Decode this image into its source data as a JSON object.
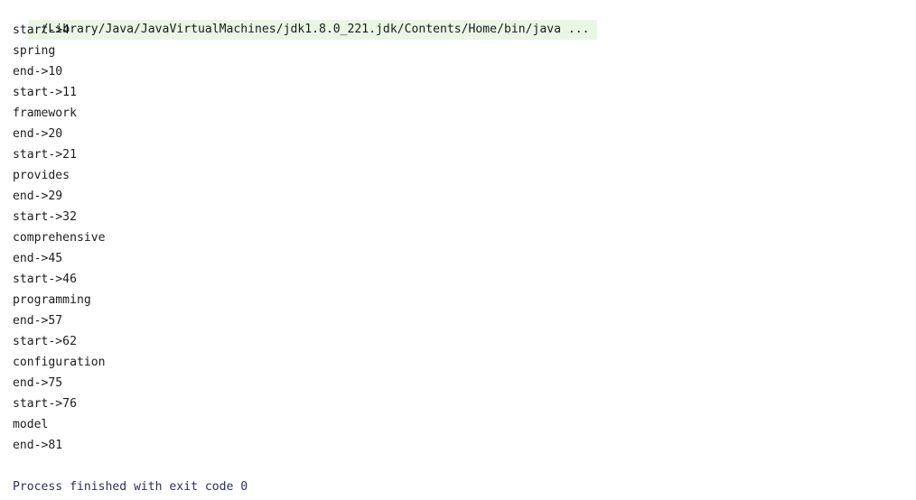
{
  "console": {
    "background_color": "#ffffff",
    "command_highlight_color": "#e9f6e4",
    "text_color": "#1c1c1c",
    "exit_status_color": "#2e2e63",
    "command_line": "/Library/Java/JavaVirtualMachines/jdk1.8.0_221.jdk/Contents/Home/bin/java ...",
    "output_lines": [
      "start->4",
      "spring",
      "end->10",
      "start->11",
      "framework",
      "end->20",
      "start->21",
      "provides",
      "end->29",
      "start->32",
      "comprehensive",
      "end->45",
      "start->46",
      "programming",
      "end->57",
      "start->62",
      "configuration",
      "end->75",
      "start->76",
      "model",
      "end->81"
    ],
    "blank_line": "",
    "exit_status": "Process finished with exit code 0"
  }
}
